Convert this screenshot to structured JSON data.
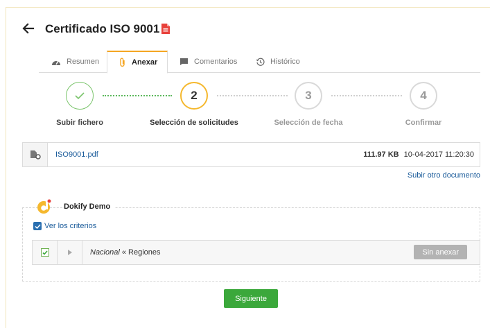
{
  "header": {
    "title": "Certificado ISO 9001"
  },
  "tabs": [
    {
      "label": "Resumen",
      "icon": "dashboard-icon"
    },
    {
      "label": "Anexar",
      "icon": "paperclip-icon",
      "active": true
    },
    {
      "label": "Comentarios",
      "icon": "comment-icon"
    },
    {
      "label": "Histórico",
      "icon": "history-icon"
    }
  ],
  "steps": [
    {
      "number": "✓",
      "label": "Subir fichero",
      "state": "done"
    },
    {
      "number": "2",
      "label": "Selección de solicitudes",
      "state": "active"
    },
    {
      "number": "3",
      "label": "Selección de fecha",
      "state": "todo"
    },
    {
      "number": "4",
      "label": "Confirmar",
      "state": "todo"
    }
  ],
  "file": {
    "name": "ISO9001.pdf",
    "size": "111.97 KB",
    "date": "10-04-2017 11:20:30"
  },
  "upload_other": "Subir otro documento",
  "company": {
    "name": "Dokify Demo",
    "criteria_label": "Ver los criterios"
  },
  "requirement": {
    "scope": "Nacional",
    "rest": " « Regiones",
    "action": "Sin anexar"
  },
  "next_button": "Siguiente",
  "colors": {
    "accent": "#f5a623",
    "green": "#3ba83b",
    "link": "#1a5b9a",
    "done": "#7ac46b"
  }
}
